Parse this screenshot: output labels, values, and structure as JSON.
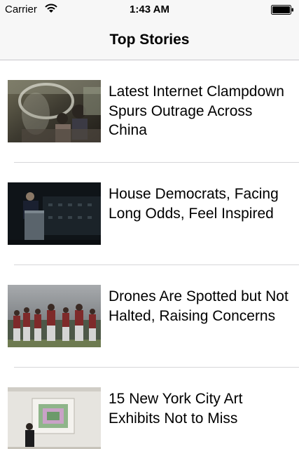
{
  "status_bar": {
    "carrier": "Carrier",
    "time": "1:43 AM"
  },
  "nav": {
    "title": "Top Stories"
  },
  "stories": [
    {
      "headline": "Latest Internet Clampdown Spurs Outrage Across China",
      "thumbnail": "internet-cafe-photo"
    },
    {
      "headline": "House Democrats, Facing Long Odds, Feel Inspired",
      "thumbnail": "speaker-podium-photo"
    },
    {
      "headline": "Drones Are Spotted but Not Halted, Raising Concerns",
      "thumbnail": "baseball-team-photo"
    },
    {
      "headline": "15 New York City Art Exhibits Not to Miss",
      "thumbnail": "art-gallery-photo"
    }
  ]
}
